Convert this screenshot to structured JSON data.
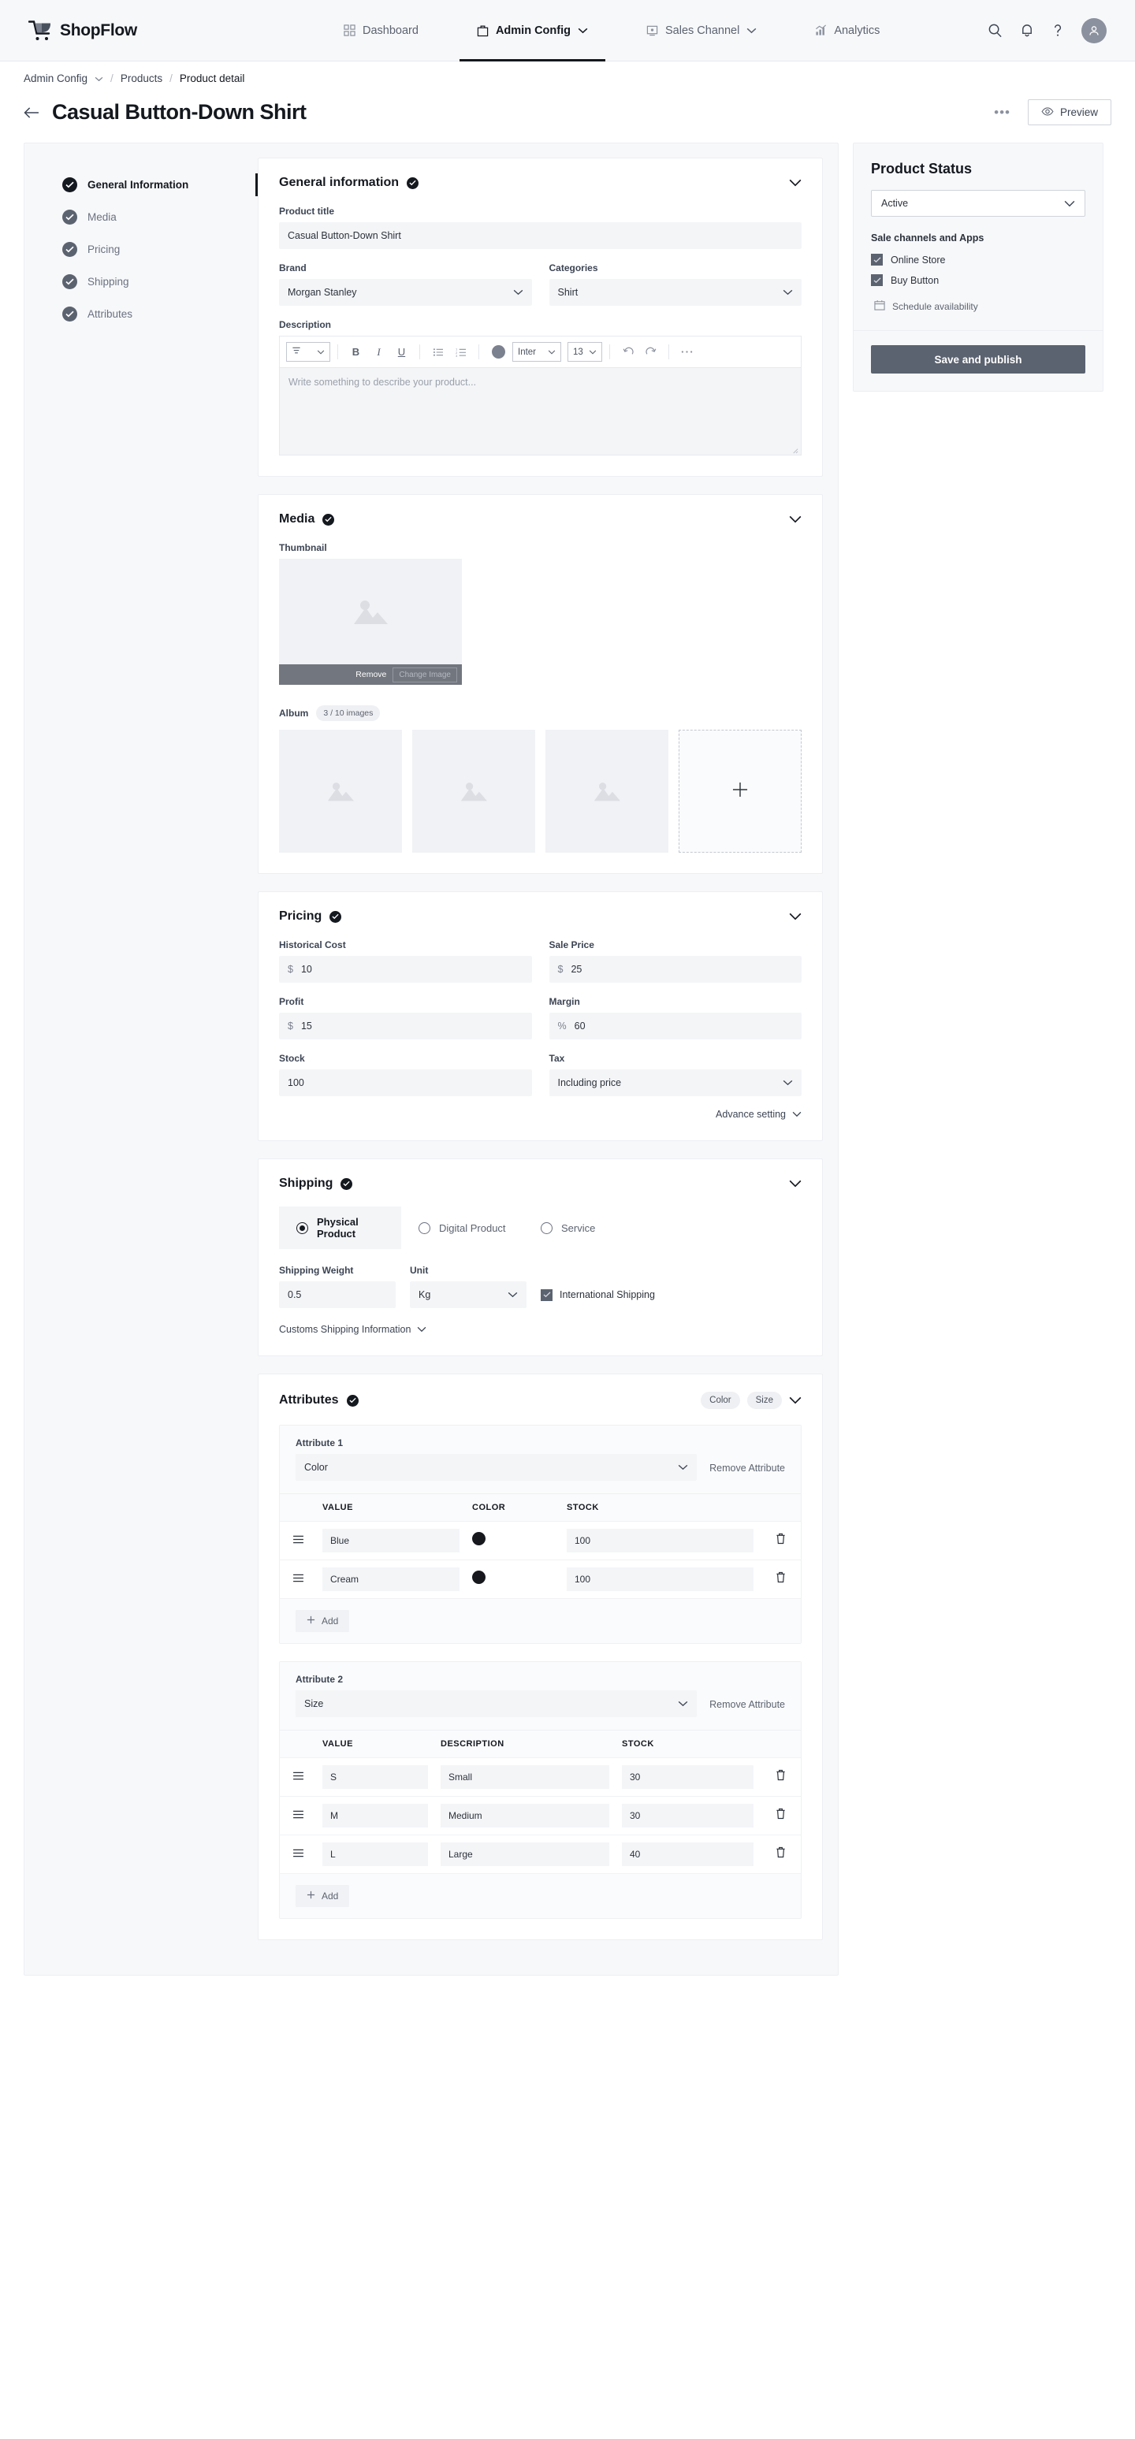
{
  "brand": {
    "name": "ShopFlow",
    "logo_icon": "shopflow-cart-icon"
  },
  "topnav": {
    "items": [
      {
        "label": "Dashboard",
        "icon": "grid-icon",
        "active": false,
        "caret": false
      },
      {
        "label": "Admin Config",
        "icon": "bag-icon",
        "active": true,
        "caret": true
      },
      {
        "label": "Sales Channel",
        "icon": "monitor-icon",
        "active": false,
        "caret": true
      },
      {
        "label": "Analytics",
        "icon": "bar-chart-icon",
        "active": false,
        "caret": false
      }
    ],
    "right_icons": [
      "search-icon",
      "bell-icon",
      "help-icon",
      "avatar"
    ]
  },
  "breadcrumb": {
    "items": [
      "Admin Config",
      "Products",
      "Product detail"
    ],
    "separator": "/"
  },
  "header": {
    "back_icon": "arrow-left-icon",
    "title": "Casual Button-Down Shirt",
    "more_label": "•••",
    "preview_label": "Preview",
    "preview_icon": "eye-icon"
  },
  "steps": [
    {
      "label": "General Information",
      "done": true,
      "current": true
    },
    {
      "label": "Media",
      "done": true,
      "current": false
    },
    {
      "label": "Pricing",
      "done": true,
      "current": false
    },
    {
      "label": "Shipping",
      "done": true,
      "current": false
    },
    {
      "label": "Attributes",
      "done": true,
      "current": false
    }
  ],
  "general": {
    "title": "General information",
    "product_title_label": "Product title",
    "product_title_value": "Casual Button-Down Shirt",
    "brand_label": "Brand",
    "brand_value": "Morgan Stanley",
    "categories_label": "Categories",
    "categories_value": "Shirt",
    "description_label": "Description",
    "description_placeholder": "Write something to describe your product...",
    "toolbar": {
      "paragraph_icon": "paragraph-style-icon",
      "bold": "B",
      "italic": "I",
      "underline": "U",
      "bullet_list_icon": "bullet-list-icon",
      "numbered_list_icon": "numbered-list-icon",
      "color_swatch": "#7b818e",
      "font_family": "Inter",
      "font_size": "13",
      "undo_icon": "undo-icon",
      "redo_icon": "redo-icon",
      "more_icon": "more-horizontal-icon"
    }
  },
  "media": {
    "title": "Media",
    "thumbnail_label": "Thumbnail",
    "remove_label": "Remove",
    "change_label": "Change Image",
    "album_label": "Album",
    "album_count": "3 / 10 images",
    "album_items": [
      "image-placeholder",
      "image-placeholder",
      "image-placeholder"
    ],
    "add_icon": "plus-icon"
  },
  "pricing": {
    "title": "Pricing",
    "historical_cost_label": "Historical Cost",
    "historical_cost_prefix": "$",
    "historical_cost_value": "10",
    "sale_price_label": "Sale Price",
    "sale_price_prefix": "$",
    "sale_price_value": "25",
    "profit_label": "Profit",
    "profit_prefix": "$",
    "profit_value": "15",
    "margin_label": "Margin",
    "margin_prefix": "%",
    "margin_value": "60",
    "stock_label": "Stock",
    "stock_value": "100",
    "tax_label": "Tax",
    "tax_value": "Including price",
    "advance_setting_label": "Advance setting"
  },
  "shipping": {
    "title": "Shipping",
    "options": [
      {
        "label": "Physical Product",
        "selected": true
      },
      {
        "label": "Digital Product",
        "selected": false
      },
      {
        "label": "Service",
        "selected": false
      }
    ],
    "weight_label": "Shipping Weight",
    "weight_value": "0.5",
    "unit_label": "Unit",
    "unit_value": "Kg",
    "international_label": "International Shipping",
    "international_checked": true,
    "customs_label": "Customs Shipping Information"
  },
  "attributes": {
    "title": "Attributes",
    "pills": [
      "Color",
      "Size"
    ],
    "remove_attribute_label": "Remove Attribute",
    "add_label": "Add",
    "blocks": [
      {
        "index_label": "Attribute 1",
        "type_value": "Color",
        "columns": [
          "VALUE",
          "COLOR",
          "STOCK"
        ],
        "rows": [
          {
            "value": "Blue",
            "swatch": "#16181d",
            "stock": "100"
          },
          {
            "value": "Cream",
            "swatch": "#16181d",
            "stock": "100"
          }
        ]
      },
      {
        "index_label": "Attribute 2",
        "type_value": "Size",
        "columns": [
          "VALUE",
          "DESCRIPTION",
          "STOCK"
        ],
        "rows": [
          {
            "value": "S",
            "description": "Small",
            "stock": "30"
          },
          {
            "value": "M",
            "description": "Medium",
            "stock": "30"
          },
          {
            "value": "L",
            "description": "Large",
            "stock": "40"
          }
        ]
      }
    ]
  },
  "product_status": {
    "title": "Product Status",
    "status_value": "Active",
    "channels_label": "Sale channels and Apps",
    "channels": [
      {
        "label": "Online Store",
        "checked": true
      },
      {
        "label": "Buy Button",
        "checked": true
      }
    ],
    "schedule_label": "Schedule availability",
    "schedule_icon": "calendar-icon",
    "publish_label": "Save and publish"
  },
  "colors": {
    "accent": "#14181f",
    "publish_button": "#5b6270",
    "page_bg": "#ffffff",
    "panel_bg": "#f7f8fa",
    "input_bg": "#f4f5f7"
  }
}
